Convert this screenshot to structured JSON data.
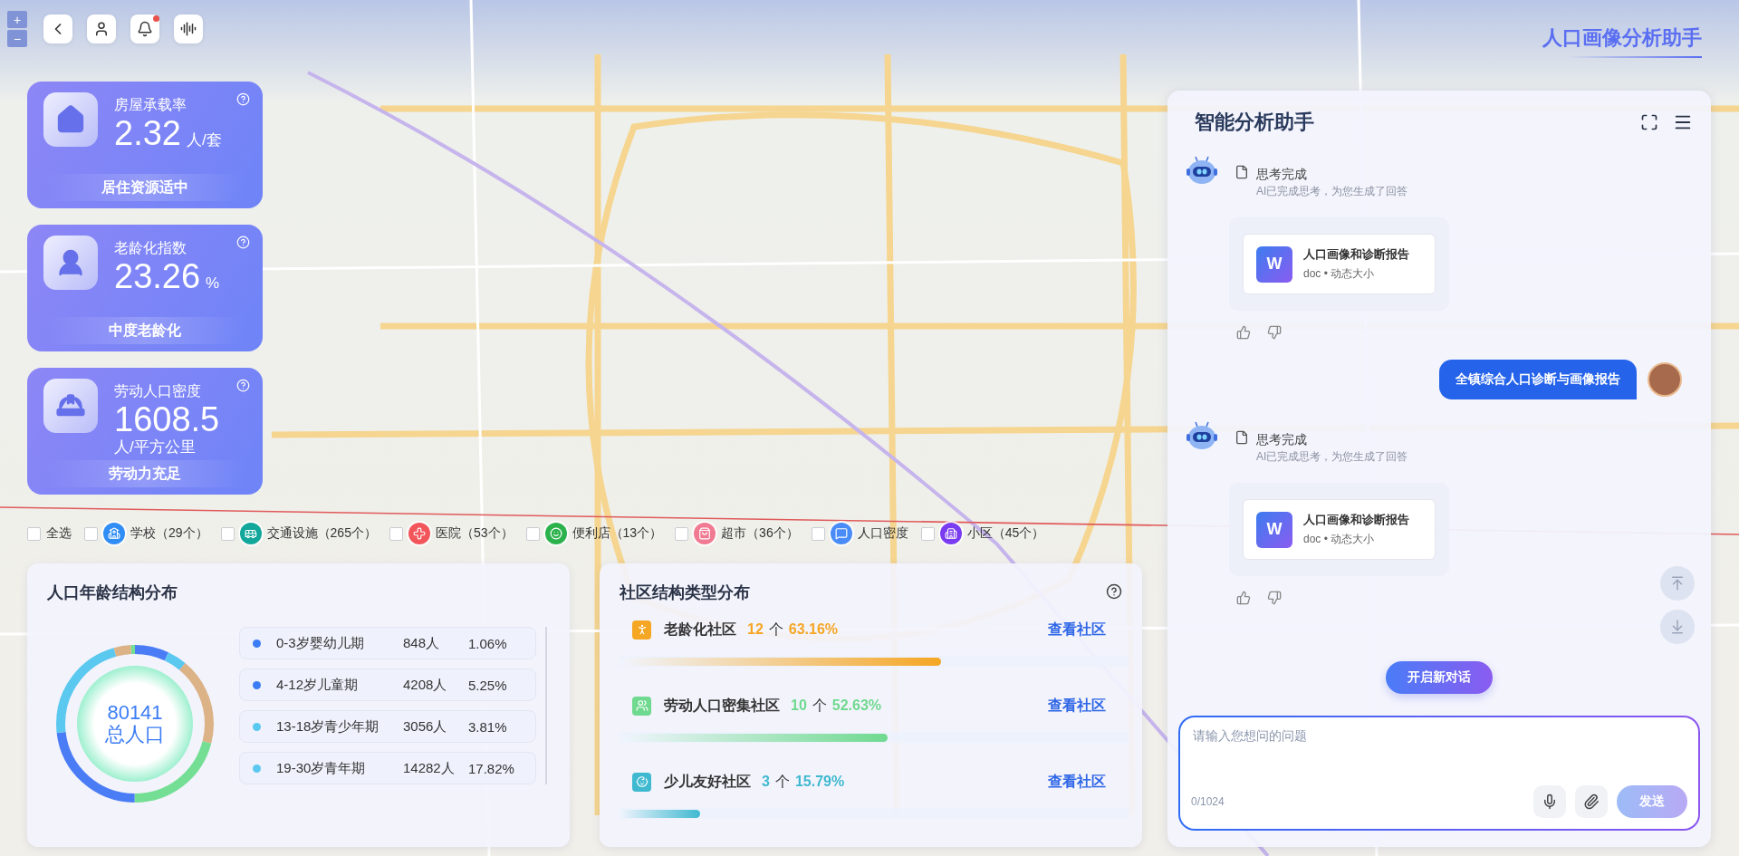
{
  "zoom_control": {
    "zoom_in": "+",
    "zoom_out": "−"
  },
  "toolbar": {
    "notification": true
  },
  "app_title": "人口画像分析助手",
  "stat_cards": [
    {
      "kind": "housing",
      "title": "房屋承载率",
      "value": "2.32",
      "unit": "人/套",
      "status": "居住资源适中"
    },
    {
      "kind": "elderly",
      "title": "老龄化指数",
      "value": "23.26",
      "unit": "%",
      "status": "中度老龄化"
    },
    {
      "kind": "worker",
      "title": "劳动人口密度",
      "value": "1608.5",
      "unit": "人/平方公里",
      "status": "劳动力充足"
    }
  ],
  "filters": [
    {
      "label": "全选",
      "checked": false
    },
    {
      "kind": "school",
      "label": "学校（29个）",
      "color": "#2f8df5",
      "checked": false
    },
    {
      "kind": "transit",
      "label": "交通设施（265个）",
      "color": "#12a79a",
      "checked": false
    },
    {
      "kind": "hospital",
      "label": "医院（53个）",
      "color": "#f2555a",
      "checked": false
    },
    {
      "kind": "store",
      "label": "便利店（13个）",
      "color": "#2bb24c",
      "checked": false
    },
    {
      "kind": "market",
      "label": "超市（36个）",
      "color": "#f07a92",
      "checked": false
    },
    {
      "kind": "density",
      "label": "人口密度",
      "color": "#4a8cf7",
      "checked": false
    },
    {
      "kind": "housing",
      "label": "小区（45个）",
      "color": "#7a3cf0",
      "checked": false
    }
  ],
  "age_panel": {
    "title": "人口年龄结构分布",
    "total": "80141",
    "total_label": "总人口",
    "groups": [
      {
        "label": "0-3岁婴幼儿期",
        "count": "848人",
        "percent": "1.06%",
        "color": "#3b7cf5"
      },
      {
        "label": "4-12岁儿童期",
        "count": "4208人",
        "percent": "5.25%",
        "color": "#3b7cf5"
      },
      {
        "label": "13-18岁青少年期",
        "count": "3056人",
        "percent": "3.81%",
        "color": "#5bc8ef"
      },
      {
        "label": "19-30岁青年期",
        "count": "14282人",
        "percent": "17.82%",
        "color": "#5bc8ef"
      }
    ]
  },
  "community_panel": {
    "title": "社区结构类型分布",
    "types": [
      {
        "kind": "elderly",
        "name": "老龄化社区",
        "count": "12",
        "unit": "个",
        "percent": "63.16%",
        "color": "#f5a623",
        "level": 0.6316,
        "action": "查看社区"
      },
      {
        "kind": "labor",
        "name": "劳动人口密集社区",
        "count": "10",
        "unit": "个",
        "percent": "52.63%",
        "color": "#6fd98f",
        "level": 0.5263,
        "action": "查看社区"
      },
      {
        "kind": "children",
        "name": "少儿友好社区",
        "count": "3",
        "unit": "个",
        "percent": "15.79%",
        "color": "#3fb9d0",
        "level": 0.1579,
        "action": "查看社区"
      }
    ]
  },
  "assistant": {
    "title": "智能分析助手",
    "messages": [
      {
        "kind": "bot",
        "status": "思考完成",
        "note": "AI已完成思考，为您生成了回答",
        "file": {
          "badge": "W",
          "name": "人口画像和诊断报告",
          "meta": "doc • 动态大小"
        }
      },
      {
        "kind": "user",
        "text": "全镇综合人口诊断与画像报告"
      },
      {
        "kind": "bot",
        "status": "思考完成",
        "note": "AI已完成思考，为您生成了回答",
        "file": {
          "badge": "W",
          "name": "人口画像和诊断报告",
          "meta": "doc • 动态大小"
        }
      }
    ],
    "new_chat": "开启新对话",
    "input": {
      "placeholder": "请输入您想问的问题",
      "counter": "0/1024",
      "send": "发送",
      "send_disabled": true
    }
  }
}
